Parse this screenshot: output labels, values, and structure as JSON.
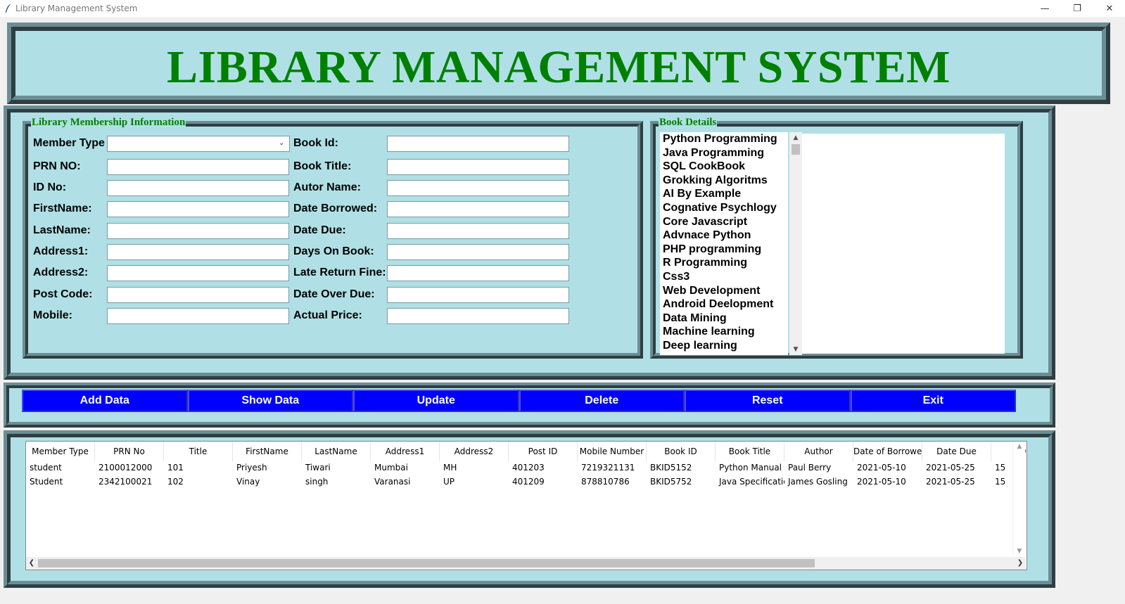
{
  "window": {
    "title": "Library Management System",
    "minimize": "—",
    "maximize": "❐",
    "close": "✕"
  },
  "header": {
    "title": "LIBRARY MANAGEMENT SYSTEM"
  },
  "member_frame": {
    "title": "Library Membership Information",
    "fields": [
      {
        "label": "Member Type",
        "value": ""
      },
      {
        "label": "PRN NO:",
        "value": ""
      },
      {
        "label": "ID No:",
        "value": ""
      },
      {
        "label": "FirstName:",
        "value": ""
      },
      {
        "label": "LastName:",
        "value": ""
      },
      {
        "label": "Address1:",
        "value": ""
      },
      {
        "label": "Address2:",
        "value": ""
      },
      {
        "label": "Post Code:",
        "value": ""
      },
      {
        "label": "Mobile:",
        "value": ""
      }
    ],
    "book_fields": [
      {
        "label": "Book Id:",
        "value": ""
      },
      {
        "label": "Book Title:",
        "value": ""
      },
      {
        "label": "Autor Name:",
        "value": ""
      },
      {
        "label": "Date Borrowed:",
        "value": ""
      },
      {
        "label": "Date Due:",
        "value": ""
      },
      {
        "label": "Days On Book:",
        "value": ""
      },
      {
        "label": "Late Return Fine:",
        "value": ""
      },
      {
        "label": "Date Over Due:",
        "value": ""
      },
      {
        "label": "Actual Price:",
        "value": ""
      }
    ]
  },
  "book_frame": {
    "title": "Book Details",
    "books": [
      "Python Programming",
      "Java Programming",
      "SQL CookBook",
      "Grokking Algoritms",
      "AI By Example",
      "Cognative Psychlogy",
      "Core Javascript",
      "Advnace Python",
      "PHP programming",
      "R Programming",
      "Css3",
      "Web Development",
      "Android Deelopment",
      "Data Mining",
      "Machine learning",
      "Deep learning"
    ],
    "details_text": ""
  },
  "buttons": {
    "add": "Add Data",
    "show": "Show Data",
    "update": "Update",
    "delete": "Delete",
    "reset": "Reset",
    "exit": "Exit"
  },
  "table": {
    "columns": [
      "Member Type",
      "PRN No",
      "Title",
      "FirstName",
      "LastName",
      "Address1",
      "Address2",
      "Post ID",
      "Mobile Number",
      "Book ID",
      "Book Title",
      "Author",
      "Date of Borrowed",
      "Date Due",
      "Da"
    ],
    "rows": [
      [
        "student",
        "2100012000",
        "101",
        "Priyesh",
        "Tiwari",
        "Mumbai",
        "MH",
        "401203",
        "7219321131",
        "BKID5152",
        "Python Manual",
        "Paul Berry",
        "2021-05-10",
        "2021-05-25",
        "15"
      ],
      [
        "Student",
        "2342100021",
        "102",
        "Vinay",
        "singh",
        "Varanasi",
        "UP",
        "401209",
        "878810786",
        "BKID5752",
        "Java Specification",
        "James Gosling",
        "2021-05-10",
        "2021-05-25",
        "15"
      ]
    ]
  },
  "scroll": {
    "up": "^",
    "down": "v",
    "left": "<",
    "right": ">"
  }
}
